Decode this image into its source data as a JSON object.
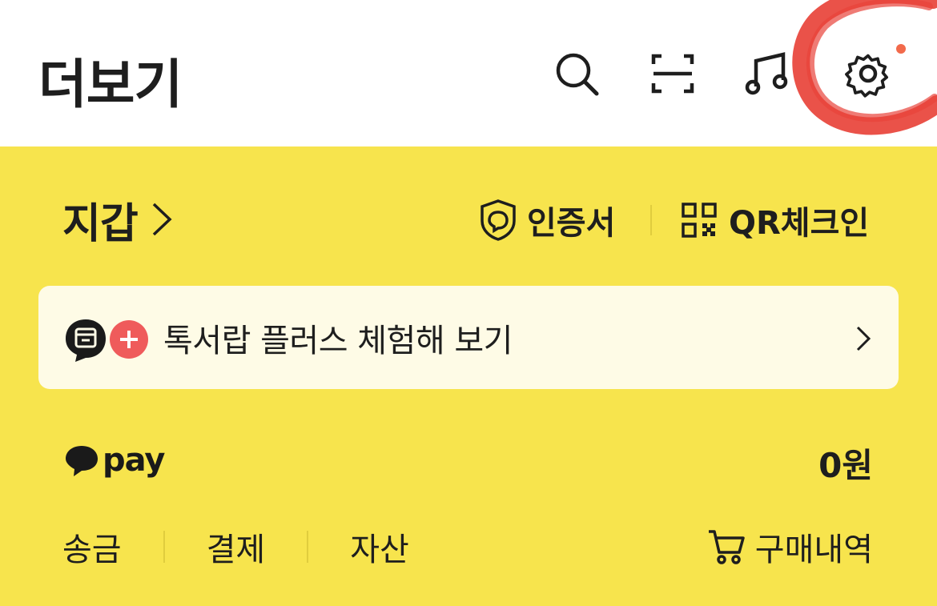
{
  "header": {
    "title": "더보기",
    "icons": [
      "search-icon",
      "scan-icon",
      "music-icon",
      "settings-gear-icon"
    ],
    "notification_dot_color": "#f26a4b"
  },
  "colors": {
    "panel_background": "#f7e44d",
    "promo_background": "#fefbe6",
    "annotation_circle": "#e8433a"
  },
  "wallet": {
    "label": "지갑",
    "certificate_label": "인증서",
    "qr_checkin_label": "QR체크인"
  },
  "promo": {
    "text": "톡서랍 플러스 체험해 보기"
  },
  "pay": {
    "logo_text": "pay",
    "balance": "0원",
    "actions": [
      "송금",
      "결제",
      "자산"
    ],
    "orders_label": "구매내역"
  }
}
